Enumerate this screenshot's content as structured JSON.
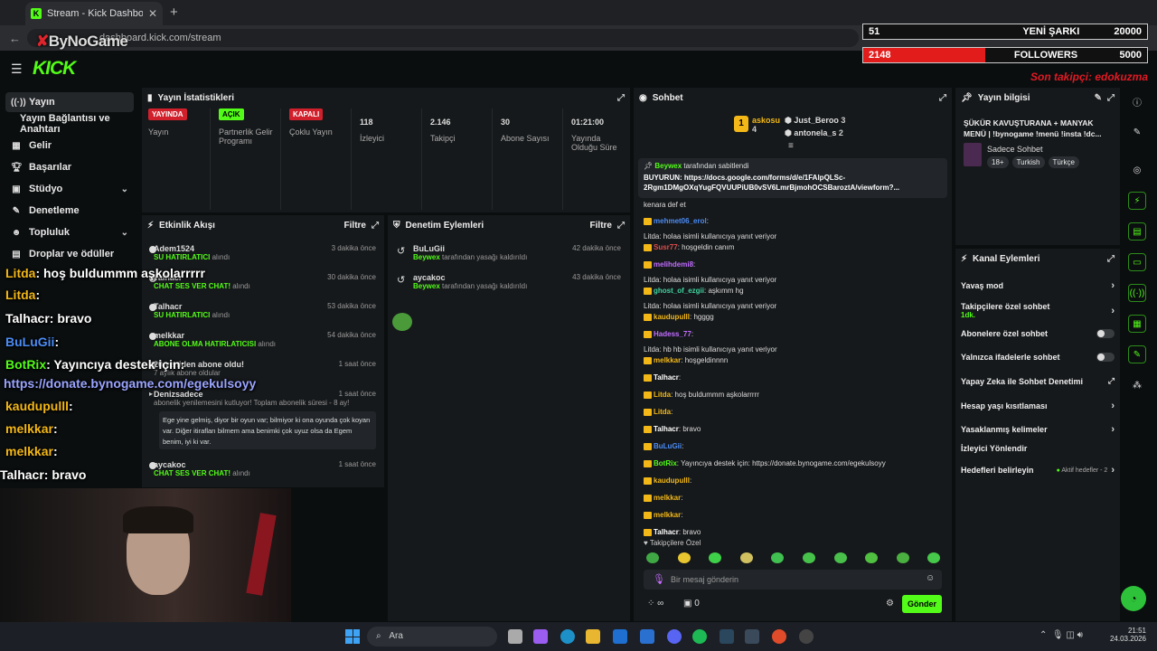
{
  "browser": {
    "tab_title": "Stream - Kick Dashboard",
    "url": "dashboard.kick.com/stream"
  },
  "overlay": {
    "brand": "ByNoGame",
    "songs_left": "51",
    "songs_label": "YENİ ŞARKI",
    "songs_goal": "20000",
    "followers_value": "2148",
    "followers_label": "FOLLOWERS",
    "followers_goal": "5000",
    "followers_progress": 0.43,
    "last_follower": "Son takipçi: edokuzma"
  },
  "header": {
    "logo": "KICK"
  },
  "sidebar": {
    "items": [
      {
        "label": "Yayın",
        "icon": "broadcast-icon"
      },
      {
        "label": "Yayın Bağlantısı ve Anahtarı"
      },
      {
        "label": "Gelir",
        "icon": "chart-icon"
      },
      {
        "label": "Başarılar",
        "icon": "trophy-icon"
      },
      {
        "label": "Stüdyo",
        "icon": "studio-icon"
      },
      {
        "label": "Denetleme",
        "icon": "wrench-icon"
      },
      {
        "label": "Topluluk",
        "icon": "people-icon"
      },
      {
        "label": "Droplar ve ödüller",
        "icon": "gift-icon"
      }
    ]
  },
  "stats": {
    "title": "Yayın İstatistikleri",
    "items": [
      {
        "badge": "YAYINDA",
        "label": "Yayın",
        "color": "#d1202b"
      },
      {
        "badge": "AÇIK",
        "label": "Partnerlik Gelir Programı",
        "color": "#53fc18"
      },
      {
        "badge": "KAPALI",
        "label": "Çoklu Yayın",
        "color": "#d1202b"
      },
      {
        "value": "118",
        "label": "İzleyici"
      },
      {
        "value": "2.146",
        "label": "Takipçi"
      },
      {
        "value": "30",
        "label": "Abone Sayısı"
      },
      {
        "value": "01:21:00",
        "label": "Yayında Olduğu Süre"
      }
    ]
  },
  "activity": {
    "title": "Etkinlik Akışı",
    "filter": "Filtre",
    "items": [
      {
        "name": "Adem1524",
        "sub": "SU HATIRLATICI",
        "tail": "alındı",
        "time": "3 dakika önce"
      },
      {
        "name": "Talhacr",
        "sub": "CHAT SES VER CHAT!",
        "tail": "alındı",
        "time": "30 dakika önce"
      },
      {
        "name": "Talhacr",
        "sub": "SU HATIRLATICI",
        "tail": "alındı",
        "time": "53 dakika önce"
      },
      {
        "name": "melkkar",
        "sub": "ABONE OLMA HATIRLATICISI",
        "tail": "alındı",
        "time": "54 dakika önce"
      },
      {
        "name": "20 yeniden abone oldu!",
        "sub": "7 aylık abone oldular",
        "tail": "",
        "time": "1 saat önce"
      },
      {
        "name": "Denizsadece",
        "sub": "abonelik yenilemesini kutluyor! Toplam abonelik süresi - 8 ay!",
        "tail": "",
        "time": "1 saat önce"
      },
      {
        "name": "aycakoc",
        "sub": "CHAT SES VER CHAT!",
        "tail": "alındı",
        "time": "1 saat önce"
      }
    ],
    "quote": "Ege yine gelmiş, diyor bir oyun var; bilmiyor ki ona oyunda çok koyan var. Diğer itirafları bilmem ama benimki çok uyuz olsa da Egem benim, iyi ki var."
  },
  "moderation": {
    "title": "Denetim Eylemleri",
    "filter": "Filtre",
    "items": [
      {
        "name": "BuLuGii",
        "actor": "Beywex",
        "text": "tarafından yasağı kaldırıldı",
        "time": "42 dakika önce"
      },
      {
        "name": "aycakoc",
        "actor": "Beywex",
        "text": "tarafından yasağı kaldırıldı",
        "time": "43 dakika önce"
      }
    ]
  },
  "stream_chat": [
    {
      "user": "Litda",
      "text": ": hoş buldummm aşkolarrrrr",
      "color": "#f3b818"
    },
    {
      "user": "Litda",
      "text": ":",
      "color": "#f3b818"
    },
    {
      "user": "Talhacr",
      "text": ": bravo",
      "color": "#ffffff"
    },
    {
      "user": "BuLuGii",
      "text": ":",
      "color": "#4b8cf5"
    },
    {
      "user": "BotRix",
      "text": ": Yayıncıya destek için:",
      "color": "#53fc18"
    },
    {
      "user": "",
      "text": "https://donate.bynogame.com/egekulsoyy",
      "color": "#9aa4ff"
    },
    {
      "user": "kaudupulll",
      "text": ":",
      "color": "#f3b818"
    },
    {
      "user": "melkkar",
      "text": ":",
      "color": "#f3b818"
    },
    {
      "user": "melkkar",
      "text": ":",
      "color": "#f3b818"
    },
    {
      "user": "Talhacr",
      "text": ": bravo",
      "color": "#ffffff"
    }
  ],
  "chat": {
    "title": "Sohbet",
    "top": [
      {
        "name": "askosu",
        "count": "4"
      },
      {
        "name": "Just_Beroo",
        "count": "3"
      },
      {
        "name": "antonela_s",
        "count": "2"
      }
    ],
    "pinned": {
      "by": "Beywex",
      "by_text": "tarafından sabitlendi",
      "text": "BUYURUN: https://docs.google.com/forms/d/e/1FAlpQLSc-2Rgm1DMgOXqYugFQVUUPiUB0vSV6LmrBjmohOCSBaroztA/viewform?..."
    },
    "messages": [
      {
        "user": "",
        "text": "kenara def et",
        "color": "#ddd",
        "reply": ""
      },
      {
        "user": "mehmet06_erol",
        "text": ":",
        "color": "#4b8cf5",
        "reply": ""
      },
      {
        "user": "Susr77",
        "text": ": hoşgeldin canım",
        "color": "#e04b4b",
        "reply": "Litda: holaa isimli kullanıcıya yanıt veriyor"
      },
      {
        "user": "melihdemi8",
        "text": ":",
        "color": "#c06cff",
        "reply": ""
      },
      {
        "user": "ghost_of_ezgii",
        "text": ": aşkımm hg",
        "color": "#3fd3a0",
        "reply": "Litda: holaa isimli kullanıcıya yanıt veriyor"
      },
      {
        "user": "kaudupulll",
        "text": ": hgggg",
        "color": "#f3b818",
        "reply": "Litda: holaa isimli kullanıcıya yanıt veriyor"
      },
      {
        "user": "Hadess_77",
        "text": ":",
        "color": "#c06cff",
        "reply": ""
      },
      {
        "user": "melkkar",
        "text": ": hoşgeldinnnn",
        "color": "#f3b818",
        "reply": "Litda: hb hb isimli kullanıcıya yanıt veriyor"
      },
      {
        "user": "Talhacr",
        "text": ":",
        "color": "#ffffff",
        "reply": ""
      },
      {
        "user": "Litda",
        "text": ": hoş buldummm aşkolarrrrr",
        "color": "#f3b818",
        "reply": ""
      },
      {
        "user": "Litda",
        "text": ":",
        "color": "#f3b818",
        "reply": ""
      },
      {
        "user": "Talhacr",
        "text": ": bravo",
        "color": "#ffffff",
        "reply": ""
      },
      {
        "user": "BuLuGii",
        "text": ":",
        "color": "#4b8cf5",
        "reply": ""
      },
      {
        "user": "BotRix",
        "text": ": Yayıncıya destek için: https://donate.bynogame.com/egekulsoyy",
        "color": "#53fc18",
        "reply": ""
      },
      {
        "user": "kaudupulll",
        "text": ":",
        "color": "#f3b818",
        "reply": ""
      },
      {
        "user": "melkkar",
        "text": ":",
        "color": "#f3b818",
        "reply": ""
      },
      {
        "user": "melkkar",
        "text": ":",
        "color": "#f3b818",
        "reply": ""
      },
      {
        "user": "Talhacr",
        "text": ": bravo",
        "color": "#ffffff",
        "reply": ""
      }
    ],
    "followers_only": "Takipçilere Özel",
    "placeholder": "Bir mesaj gönderin",
    "send": "Gönder",
    "viewers": "∞",
    "gifts": "0"
  },
  "stream_info": {
    "title": "Yayın bilgisi",
    "stream_title": "ŞÜKÜR KAVUŞTURANA + MANYAK MENÜ | !bynogame !menü !insta !dc...",
    "category": "Sadece Sohbet",
    "tags": [
      "18+",
      "Turkish",
      "Türkçe"
    ]
  },
  "channel_actions": {
    "title": "Kanal Eylemleri",
    "items": [
      {
        "label": "Yavaş mod",
        "type": "chev"
      },
      {
        "label": "Takipçilere özel sohbet",
        "sub": "1dk.",
        "type": "chev"
      },
      {
        "label": "Abonelere özel sohbet",
        "type": "toggle"
      },
      {
        "label": "Yalnızca ifadelerle sohbet",
        "type": "toggle"
      },
      {
        "label": "Yapay Zeka ile Sohbet Denetimi",
        "type": "ext"
      },
      {
        "label": "Hesap yaşı kısıtlaması",
        "type": "chev"
      },
      {
        "label": "Yasaklanmış kelimeler",
        "type": "chev"
      },
      {
        "label": "İzleyici Yönlendir",
        "type": "none"
      },
      {
        "label": "Hedefleri belirleyin",
        "sub": "Aktif hedefler - 2",
        "type": "chev"
      }
    ]
  },
  "taskbar": {
    "search": "Ara",
    "time": "21:51",
    "date": "24.03.2026"
  },
  "colors": {
    "accent": "#53fc18",
    "bg": "#0b0e0f",
    "panel": "#16191b"
  }
}
